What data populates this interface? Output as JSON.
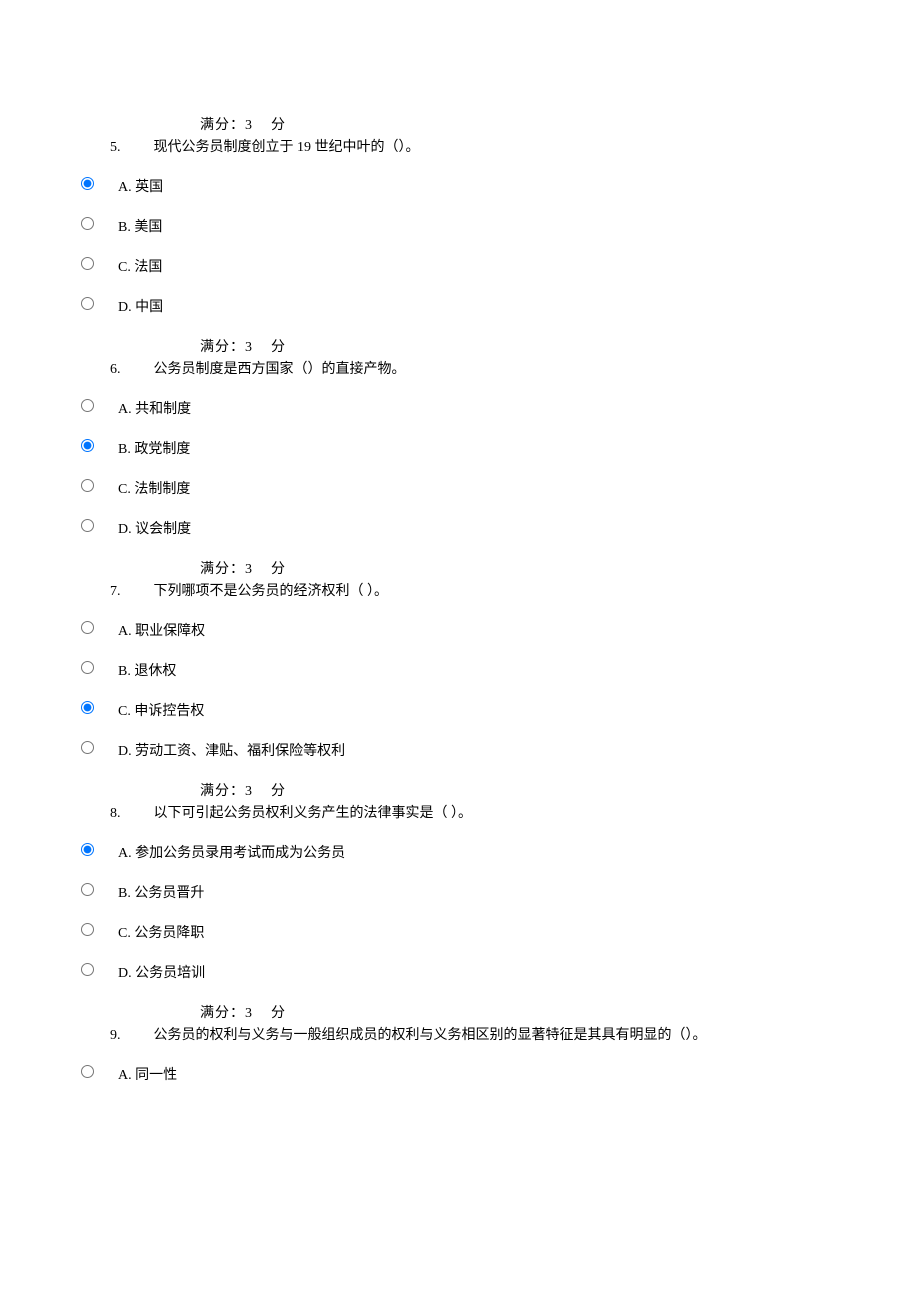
{
  "score_label_prefix": "满分：",
  "score_value": "3",
  "score_label_suffix": "分",
  "questions": [
    {
      "num": "5.",
      "text": "现代公务员制度创立于 19 世纪中叶的（）。",
      "selected": 0,
      "options": [
        "A. 英国",
        "B. 美国",
        "C. 法国",
        "D. 中国"
      ]
    },
    {
      "num": "6.",
      "text": "公务员制度是西方国家（）的直接产物。",
      "selected": 1,
      "options": [
        "A. 共和制度",
        "B. 政党制度",
        "C. 法制制度",
        "D. 议会制度"
      ]
    },
    {
      "num": "7.",
      "text": "下列哪项不是公务员的经济权利（  ）。",
      "selected": 2,
      "options": [
        "A. 职业保障权",
        "B. 退休权",
        "C. 申诉控告权",
        "D. 劳动工资、津贴、福利保险等权利"
      ]
    },
    {
      "num": "8.",
      "text": "以下可引起公务员权利义务产生的法律事实是（  ）。",
      "selected": 0,
      "options": [
        "A. 参加公务员录用考试而成为公务员",
        "B. 公务员晋升",
        "C. 公务员降职",
        "D. 公务员培训"
      ]
    },
    {
      "num": "9.",
      "text": "公务员的权利与义务与一般组织成员的权利与义务相区别的显著特征是其具有明显的（）。",
      "selected": -1,
      "options": [
        "A. 同一性"
      ]
    }
  ]
}
